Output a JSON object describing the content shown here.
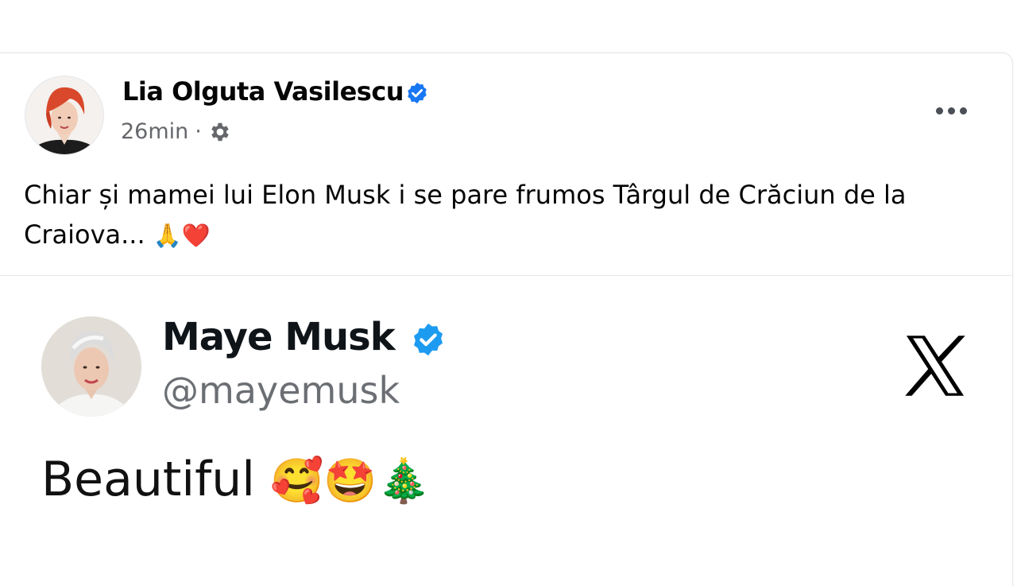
{
  "post": {
    "author_name": "Lia Olguta Vasilescu",
    "timestamp": "26min",
    "separator": "·",
    "audience_icon": "gear-icon",
    "more_icon": "more-options-icon",
    "text": "Chiar și mamei lui Elon Musk i se pare frumos Târgul de Crăciun de la Craiova...",
    "text_emojis": "🙏❤️"
  },
  "tweet": {
    "display_name": "Maye Musk",
    "handle": "@mayemusk",
    "text": "Beautiful",
    "emojis": "🥰🤩🎄",
    "brand_icon": "x-logo-icon"
  },
  "colors": {
    "verified": "#1877f2",
    "tweet_verified": "#1d9bf0",
    "secondary_text": "#65676b",
    "divider": "#e4e6eb"
  }
}
